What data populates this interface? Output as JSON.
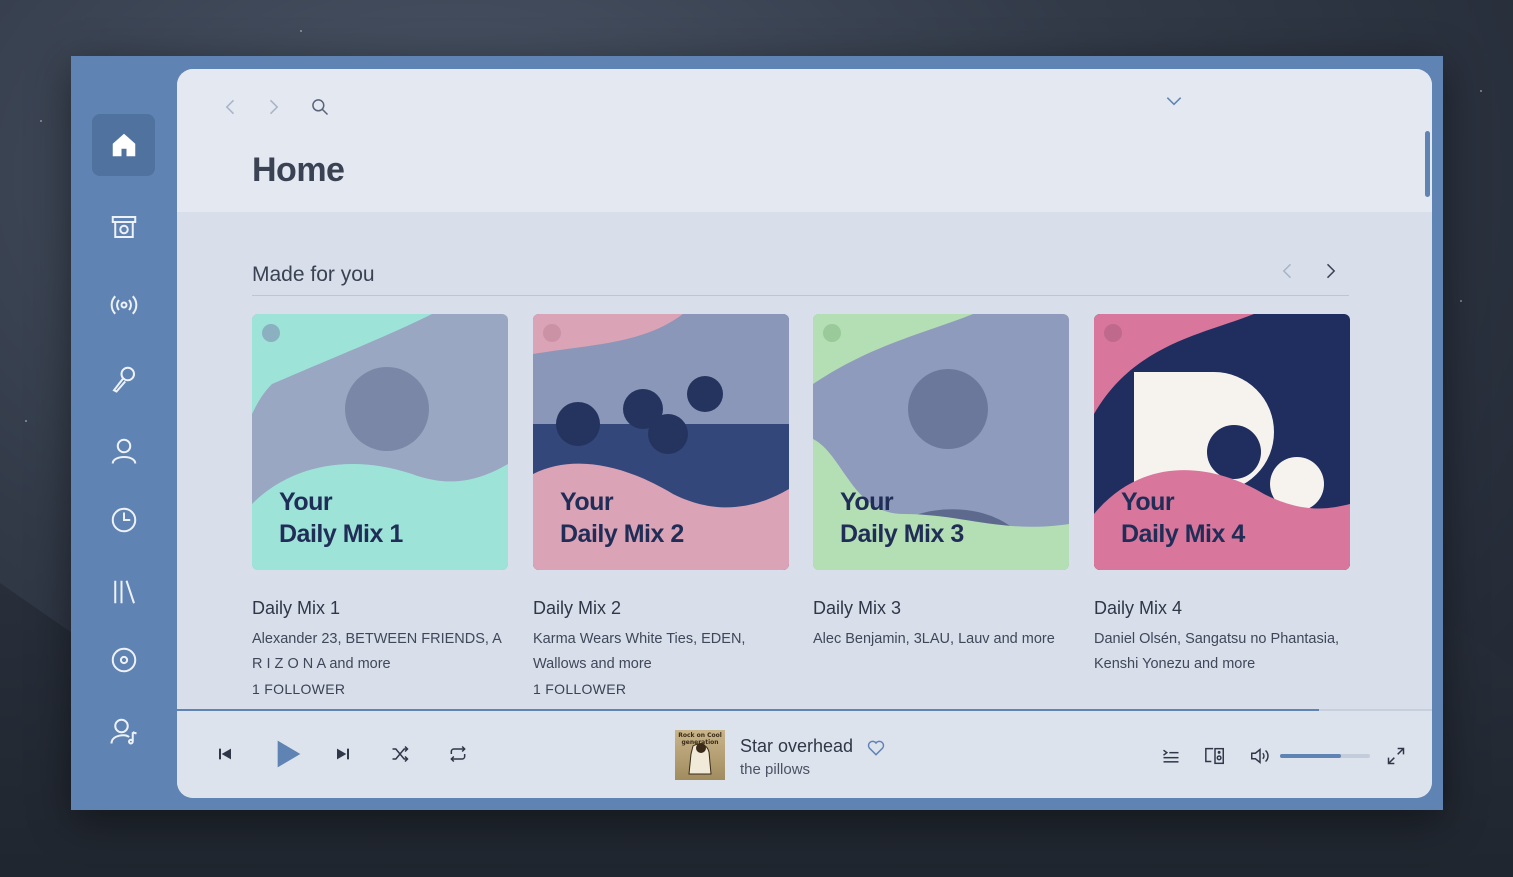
{
  "sidebar": {
    "items": [
      {
        "icon": "home-icon",
        "active": true
      },
      {
        "icon": "browse-icon",
        "active": false
      },
      {
        "icon": "radio-icon",
        "active": false
      },
      {
        "icon": "microphone-icon",
        "active": false
      },
      {
        "icon": "user-icon",
        "active": false
      },
      {
        "icon": "recent-clock-icon",
        "active": false
      },
      {
        "icon": "library-icon",
        "active": false
      },
      {
        "icon": "disc-icon",
        "active": false
      },
      {
        "icon": "user-music-icon",
        "active": false
      }
    ]
  },
  "header": {
    "title": "Home"
  },
  "section": {
    "title": "Made for you",
    "cards": [
      {
        "cover_line1": "Your",
        "cover_line2": "Daily Mix 1",
        "title": "Daily Mix 1",
        "subtitle": "Alexander 23, BETWEEN FRIENDS, A R I Z O N A and more",
        "followers": "1 FOLLOWER",
        "bg": "#9aa7c2",
        "wave": "#9ee3d8"
      },
      {
        "cover_line1": "Your",
        "cover_line2": "Daily Mix 2",
        "title": "Daily Mix 2",
        "subtitle": "Karma Wears White Ties, EDEN, Wallows and more",
        "followers": "1 FOLLOWER",
        "bg": "#34477a",
        "wave": "#dba3b6"
      },
      {
        "cover_line1": "Your",
        "cover_line2": "Daily Mix 3",
        "title": "Daily Mix 3",
        "subtitle": "Alec Benjamin, 3LAU, Lauv and more",
        "followers": "",
        "bg": "#8f9bbd",
        "wave": "#b4dfb4"
      },
      {
        "cover_line1": "Your",
        "cover_line2": "Daily Mix 4",
        "title": "Daily Mix 4",
        "subtitle": "Daniel Olsén, Sangatsu no Phantasia, Kenshi Yonezu and more",
        "followers": "",
        "bg": "#1f2d5f",
        "wave": "#d8769c"
      }
    ]
  },
  "player": {
    "track": "Star overhead",
    "artist": "the pillows",
    "album_art_text": "Rock on Cool generation",
    "progress": 0.91,
    "volume": 0.68
  },
  "colors": {
    "accent": "#5f83b3",
    "panel": "#d8dfeb",
    "topbar": "#e3e8f1",
    "text": "#3a4253"
  }
}
